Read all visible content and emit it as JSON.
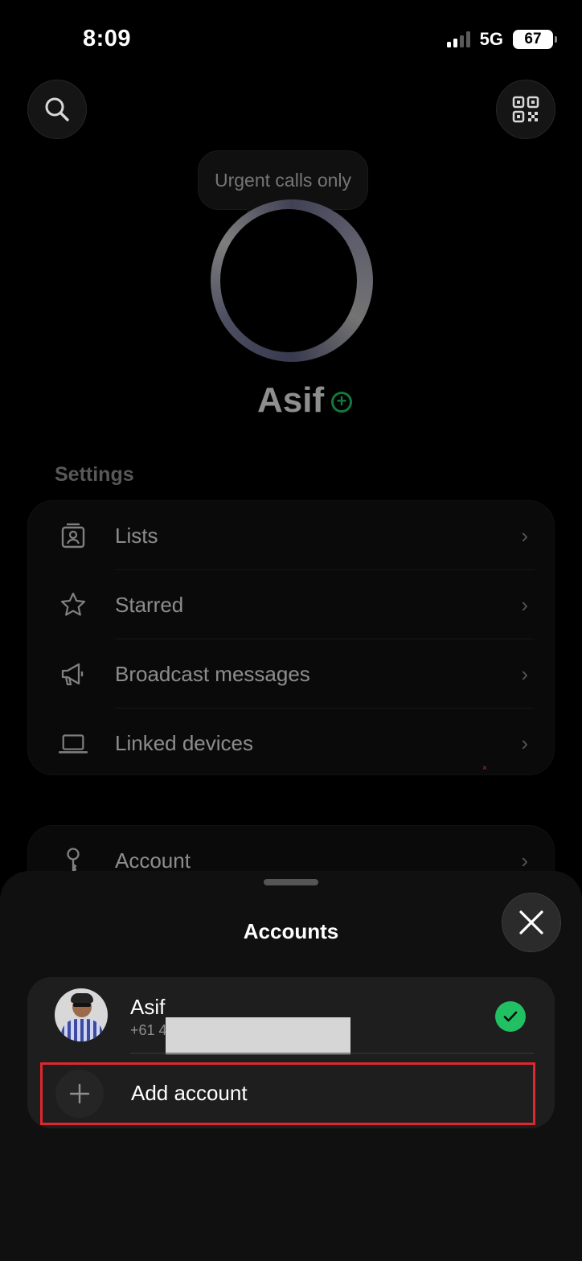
{
  "status_bar": {
    "time": "8:09",
    "network": "5G",
    "battery": "67"
  },
  "profile": {
    "status_text": "Urgent calls only",
    "name": "Asif"
  },
  "settings": {
    "title": "Settings",
    "items": [
      {
        "label": "Lists",
        "icon": "lists-icon"
      },
      {
        "label": "Starred",
        "icon": "star-icon"
      },
      {
        "label": "Broadcast messages",
        "icon": "megaphone-icon"
      },
      {
        "label": "Linked devices",
        "icon": "laptop-icon"
      }
    ],
    "account_label": "Account"
  },
  "sheet": {
    "title": "Accounts",
    "account": {
      "name": "Asif",
      "phone_prefix": "+61 4"
    },
    "add_label": "Add account"
  },
  "colors": {
    "accent_green": "#21c063",
    "highlight_red": "#e0262f"
  }
}
